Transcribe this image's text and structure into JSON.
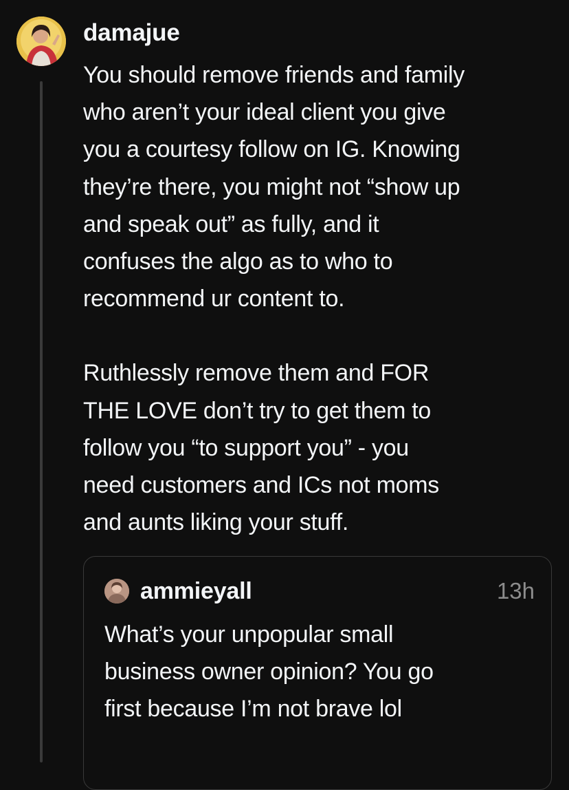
{
  "post": {
    "username": "damajue",
    "avatar_icon": "profile-photo-icon",
    "paragraphs": [
      "You should remove friends and family\nwho aren’t your ideal client you give\nyou a courtesy follow on IG. Knowing\nthey’re there, you might not “show up\nand speak out” as fully, and it\nconfuses the algo as to who to\nrecommend ur content to.",
      "Ruthlessly remove them and FOR\nTHE LOVE don’t try to get them to\nfollow you “to support you” - you\nneed customers and ICs not moms\nand aunts liking your stuff."
    ]
  },
  "quoted_post": {
    "username": "ammieyall",
    "timestamp": "13h",
    "avatar_icon": "profile-photo-icon",
    "text": "What’s your unpopular small\nbusiness owner opinion? You go\nfirst because I’m not brave lol"
  },
  "colors": {
    "background": "#0f0f0f",
    "text": "#f3f5f7",
    "secondary_text": "#8c8c8c",
    "border": "#3a3a3a"
  }
}
